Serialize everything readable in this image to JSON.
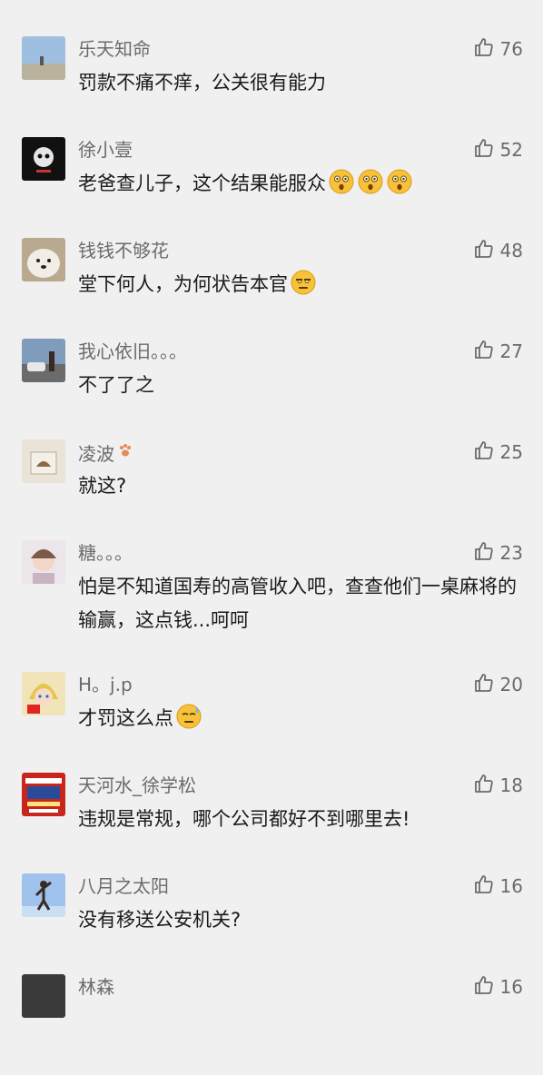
{
  "comments": [
    {
      "name": "乐天知命",
      "text": "罚款不痛不痒，公关很有能力",
      "likes": "76"
    },
    {
      "name": "徐小壹",
      "text": "老爸查儿子，这个结果能服众",
      "likes": "52",
      "emoji": [
        "astonished-face-icon",
        "astonished-face-icon",
        "astonished-face-icon"
      ]
    },
    {
      "name": "钱钱不够花",
      "text": "堂下何人，为何状告本官",
      "likes": "48",
      "emoji": [
        "unamused-face-icon"
      ]
    },
    {
      "name": "我心依旧。。。",
      "text": "不了了之",
      "likes": "27"
    },
    {
      "name": "凌波",
      "text": "就这?",
      "likes": "25",
      "name_icon": "paw-icon"
    },
    {
      "name": "糖。。。",
      "text": "怕是不知道国寿的高管收入吧，查查他们一桌麻将的输赢，这点钱...呵呵",
      "likes": "23"
    },
    {
      "name": "H。j.p",
      "text": "才罚这么点",
      "likes": "20",
      "emoji": [
        "sweat-face-icon"
      ]
    },
    {
      "name": "天河水_徐学松",
      "text": "违规是常规，哪个公司都好不到哪里去!",
      "likes": "18"
    },
    {
      "name": "八月之太阳",
      "text": "没有移送公安机关?",
      "likes": "16"
    },
    {
      "name": "林森",
      "text": "",
      "likes": "16"
    }
  ],
  "colors": {
    "background": "#f0f0f0",
    "meta_text": "#6b6b6b",
    "body_text": "#1a1a1a"
  }
}
